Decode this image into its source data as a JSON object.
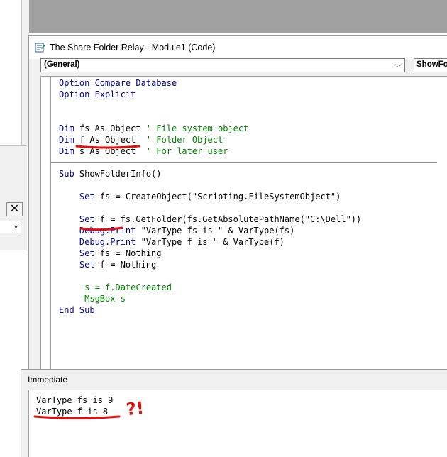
{
  "window": {
    "title": "The Share Folder Relay - Module1 (Code)"
  },
  "object_combo": {
    "value": "(General)"
  },
  "procedure_combo": {
    "value": "ShowFolderInfo"
  },
  "left_panel": {
    "close_glyph": "✕"
  },
  "code": {
    "declarations": [
      {
        "kw": "Option Compare Database",
        "rest": "",
        "comment": ""
      },
      {
        "kw": "Option Explicit",
        "rest": "",
        "comment": ""
      },
      {
        "kw": "",
        "rest": "",
        "comment": ""
      },
      {
        "kw": "",
        "rest": "",
        "comment": ""
      },
      {
        "kw": "Dim",
        "rest": " fs As Object ",
        "comment": "' File system object"
      },
      {
        "kw": "Dim",
        "rest": " f As Object  ",
        "comment": "' Folder Object"
      },
      {
        "kw": "Dim",
        "rest": " s As Object  ",
        "comment": "' For later user"
      }
    ],
    "procedure": [
      {
        "kw": "Sub",
        "rest": " ShowFolderInfo()",
        "comment": ""
      },
      {
        "kw": "",
        "rest": "",
        "comment": ""
      },
      {
        "kw": "    Set",
        "rest": " fs = CreateObject(\"Scripting.FileSystemObject\")",
        "comment": ""
      },
      {
        "kw": "",
        "rest": "",
        "comment": ""
      },
      {
        "kw": "    Set",
        "rest": " f = fs.GetFolder(fs.GetAbsolutePathName(\"C:\\Dell\"))",
        "comment": ""
      },
      {
        "kw": "    Debug.Print",
        "rest": " \"VarType fs is \" & VarType(fs)",
        "comment": ""
      },
      {
        "kw": "    Debug.Print",
        "rest": " \"VarType f is \" & VarType(f)",
        "comment": ""
      },
      {
        "kw": "    Set",
        "rest": " fs = Nothing",
        "comment": ""
      },
      {
        "kw": "    Set",
        "rest": " f = Nothing",
        "comment": ""
      },
      {
        "kw": "",
        "rest": "",
        "comment": ""
      },
      {
        "kw": "",
        "rest": "",
        "comment": "    's = f.DateCreated"
      },
      {
        "kw": "",
        "rest": "",
        "comment": "    'MsgBox s"
      },
      {
        "kw": "End Sub",
        "rest": "",
        "comment": ""
      }
    ]
  },
  "immediate": {
    "title": "Immediate",
    "lines": [
      "VarType fs is 9",
      "VarType f is 8"
    ]
  },
  "annotation": {
    "text": "?!",
    "color": "#e01010"
  },
  "colors": {
    "keyword": "#00008b",
    "comment": "#008000"
  }
}
